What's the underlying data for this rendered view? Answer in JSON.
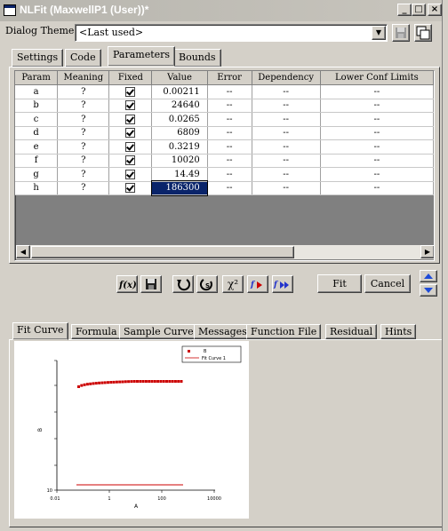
{
  "window": {
    "title": "NLFit (MaxwellP1 (User))*"
  },
  "theme": {
    "label": "Dialog Theme",
    "value": "<Last used>"
  },
  "top_tabs": [
    "Settings",
    "Code",
    "Parameters",
    "Bounds"
  ],
  "grid": {
    "columns": [
      "Param",
      "Meaning",
      "Fixed",
      "Value",
      "Error",
      "Dependency",
      "Lower Conf Limits"
    ],
    "rows": [
      {
        "param": "a",
        "meaning": "?",
        "value": "0.00211",
        "error": "--",
        "dependency": "--",
        "lower": "--"
      },
      {
        "param": "b",
        "meaning": "?",
        "value": "24640",
        "error": "--",
        "dependency": "--",
        "lower": "--"
      },
      {
        "param": "c",
        "meaning": "?",
        "value": "0.0265",
        "error": "--",
        "dependency": "--",
        "lower": "--"
      },
      {
        "param": "d",
        "meaning": "?",
        "value": "6809",
        "error": "--",
        "dependency": "--",
        "lower": "--"
      },
      {
        "param": "e",
        "meaning": "?",
        "value": "0.3219",
        "error": "--",
        "dependency": "--",
        "lower": "--"
      },
      {
        "param": "f",
        "meaning": "?",
        "value": "10020",
        "error": "--",
        "dependency": "--",
        "lower": "--"
      },
      {
        "param": "g",
        "meaning": "?",
        "value": "14.49",
        "error": "--",
        "dependency": "--",
        "lower": "--"
      },
      {
        "param": "h",
        "meaning": "?",
        "value": "186300",
        "error": "--",
        "dependency": "--",
        "lower": "--"
      }
    ]
  },
  "toolbar": {
    "fit_label": "Fit",
    "cancel_label": "Cancel",
    "chi_label": "χ²"
  },
  "bottom_tabs": [
    "Fit Curve",
    "Formula",
    "Sample Curve",
    "Messages",
    "Function File",
    "Residual",
    "Hints"
  ],
  "preview": {
    "legend": [
      "B",
      "Fit Curve 1"
    ],
    "xlabel": "A",
    "ylabel": "B",
    "x_ticks": [
      "0.01",
      "1",
      "100",
      "10000"
    ],
    "y_tick": "10"
  },
  "colors": {
    "data": "#cc0000",
    "fit": "#cc0000",
    "selected": "#0a246a"
  }
}
